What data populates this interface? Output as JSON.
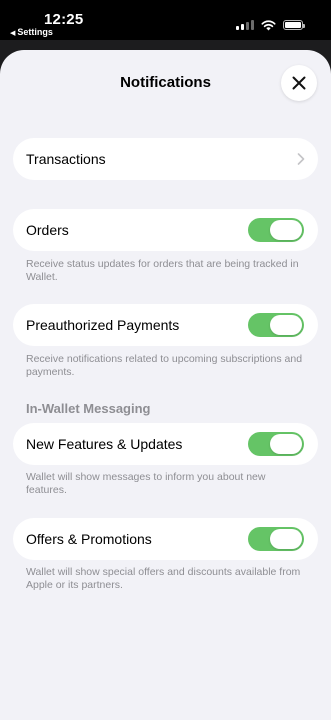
{
  "status_bar": {
    "time": "12:25",
    "back_label": "Settings",
    "back_glyph": "◀"
  },
  "sheet": {
    "title": "Notifications",
    "close_icon": "xmark-icon"
  },
  "rows": {
    "transactions": {
      "label": "Transactions",
      "icon": "chevron-right-icon"
    },
    "orders": {
      "label": "Orders",
      "enabled": true,
      "footnote": "Receive status updates for orders that are being tracked in Wallet."
    },
    "preauthorized": {
      "label": "Preauthorized Payments",
      "enabled": true,
      "footnote": "Receive notifications related to upcoming subscriptions and payments."
    },
    "in_wallet_section": "In-Wallet Messaging",
    "new_features": {
      "label": "New Features & Updates",
      "enabled": true,
      "footnote": "Wallet will show messages to inform you about new features."
    },
    "offers": {
      "label": "Offers & Promotions",
      "enabled": true,
      "footnote": "Wallet will show special offers and discounts available from Apple or its partners."
    }
  },
  "colors": {
    "toggle_on": "#65c466",
    "sheet_bg": "#f2f2f7",
    "footnote": "#8e8e93"
  }
}
